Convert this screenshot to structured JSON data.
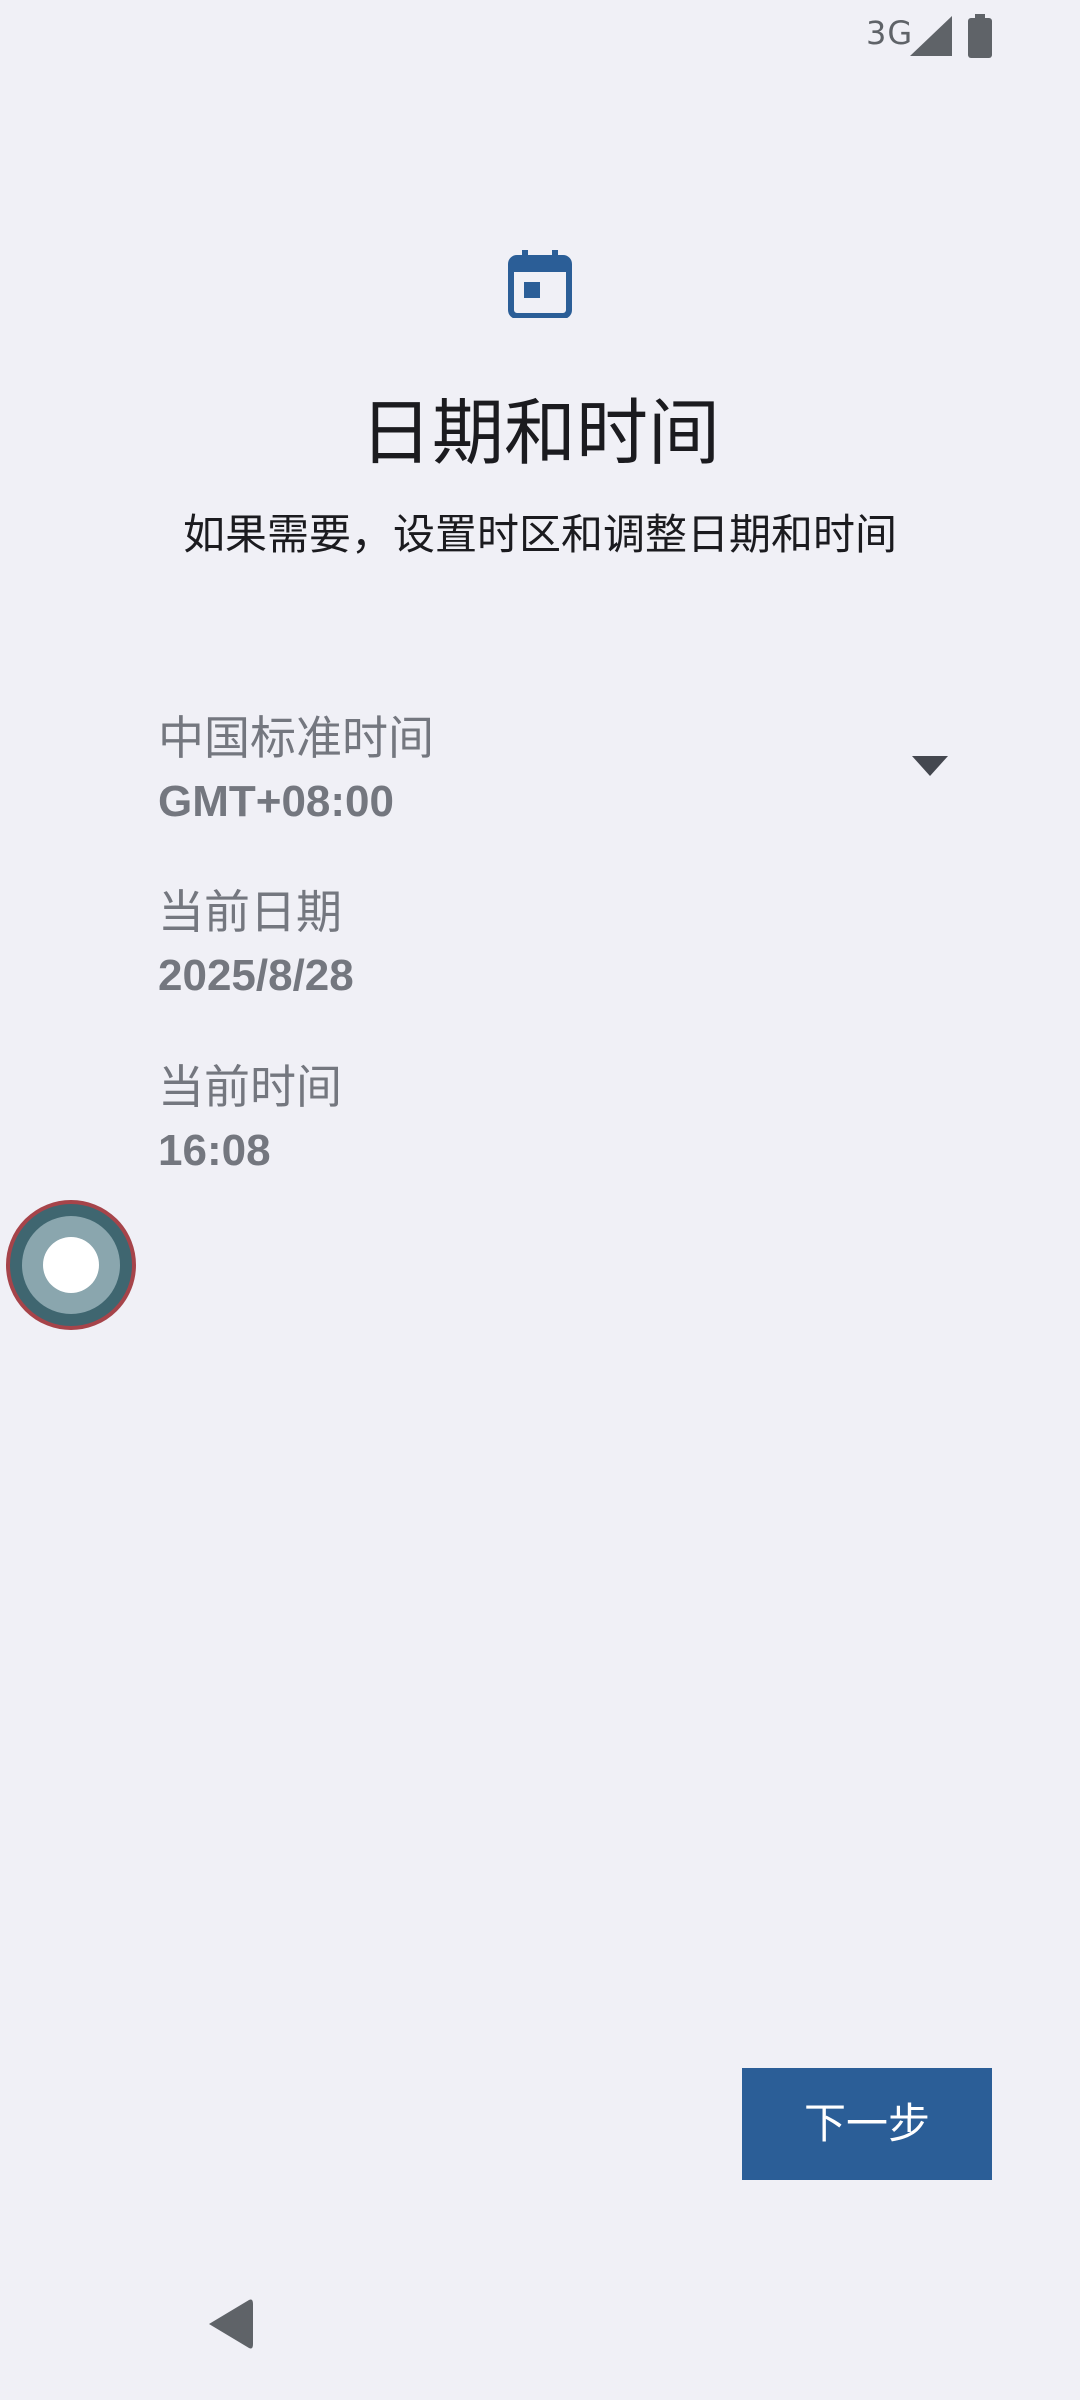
{
  "status_bar": {
    "network": "3G",
    "signal_icon": "cell-signal-icon",
    "battery_icon": "battery-icon"
  },
  "header": {
    "icon": "calendar-icon",
    "title": "日期和时间",
    "subtitle": "如果需要，设置时区和调整日期和时间"
  },
  "settings": {
    "timezone": {
      "label": "中国标准时间",
      "value": "GMT+08:00",
      "icon": "dropdown-arrow-icon"
    },
    "date": {
      "label": "当前日期",
      "value": "2025/8/28"
    },
    "time": {
      "label": "当前时间",
      "value": "16:08"
    }
  },
  "actions": {
    "next_label": "下一步"
  },
  "nav": {
    "back_icon": "back-triangle-icon"
  },
  "colors": {
    "background": "#f0f0f6",
    "accent": "#2b5e97",
    "muted_text": "#74777f"
  }
}
